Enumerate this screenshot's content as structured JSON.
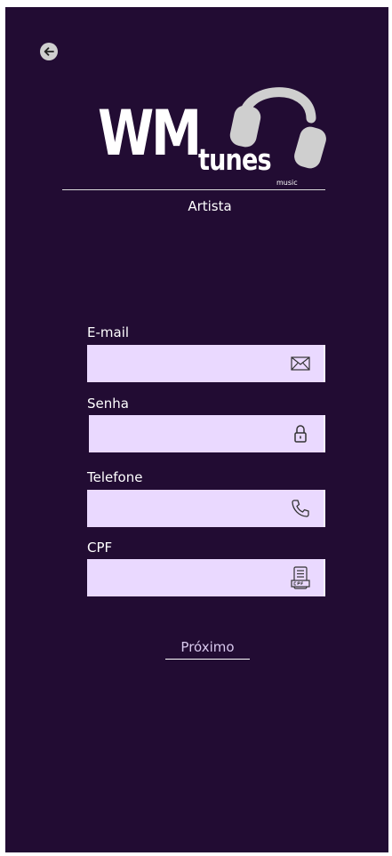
{
  "logo": {
    "brand_big": "WM",
    "brand_small": "tunes",
    "brand_tag": "music"
  },
  "subtitle": "Artista",
  "fields": {
    "email": {
      "label": "E-mail",
      "value": "",
      "icon": "envelope-icon"
    },
    "password": {
      "label": "Senha",
      "value": "",
      "icon": "lock-icon"
    },
    "phone": {
      "label": "Telefone",
      "value": "",
      "icon": "phone-icon"
    },
    "cpf": {
      "label": "CPF",
      "value": "",
      "icon": "cpf-document-icon"
    }
  },
  "actions": {
    "next_label": "Próximo",
    "back_icon": "arrow-left-icon"
  },
  "colors": {
    "background": "#220c33",
    "field_fill": "#ead9ff",
    "text": "#ffffff",
    "accent_gray": "#cfcfcf"
  }
}
